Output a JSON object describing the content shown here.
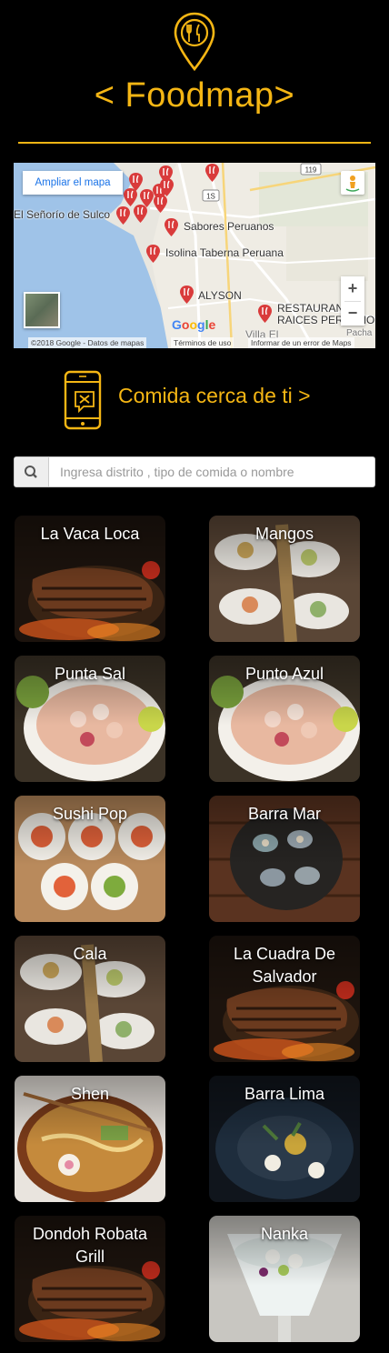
{
  "header": {
    "logo_icon": "map-pin-cutlery-icon",
    "title": "< Foodmap>",
    "accent_color": "#f5b614"
  },
  "map": {
    "enlarge_label": "Ampliar el mapa",
    "zoom_in": "+",
    "zoom_out": "−",
    "google_logo": "Google",
    "attribution": "©2018 Google - Datos de mapas",
    "terms": "Términos de uso",
    "report": "Informar de un error de Maps",
    "labels": [
      "El Señorío de Sulco",
      "Sabores Peruanos",
      "Isolina Taberna Peruana",
      "ALYSON",
      "RESTAURAN",
      "RAICES PERUANOS",
      "Villa El",
      "Pacha"
    ],
    "road_shields": [
      "1S",
      "119"
    ]
  },
  "near_me": {
    "icon": "phone-restaurant-icon",
    "label": "Comida cerca de ti >"
  },
  "search": {
    "icon": "search-icon",
    "placeholder": "Ingresa distrito , tipo de comida o nombre",
    "value": ""
  },
  "restaurants": [
    {
      "name": "La Vaca Loca",
      "photo": "grilled-steak"
    },
    {
      "name": "Mangos",
      "photo": "seafood-spoons"
    },
    {
      "name": "Punta Sal",
      "photo": "ceviche-bowl"
    },
    {
      "name": "Punto Azul",
      "photo": "ceviche-bowl"
    },
    {
      "name": "Sushi Pop",
      "photo": "sushi-rolls"
    },
    {
      "name": "Barra Mar",
      "photo": "scallops-plate"
    },
    {
      "name": "Cala",
      "photo": "seafood-spoons"
    },
    {
      "name": "La Cuadra De Salvador",
      "photo": "grilled-steak"
    },
    {
      "name": "Shen",
      "photo": "ramen-bowl"
    },
    {
      "name": "Barra Lima",
      "photo": "dark-plate"
    },
    {
      "name": "Dondoh Robata Grill",
      "photo": "grilled-steak"
    },
    {
      "name": "Nanka",
      "photo": "ceviche-glass"
    }
  ]
}
